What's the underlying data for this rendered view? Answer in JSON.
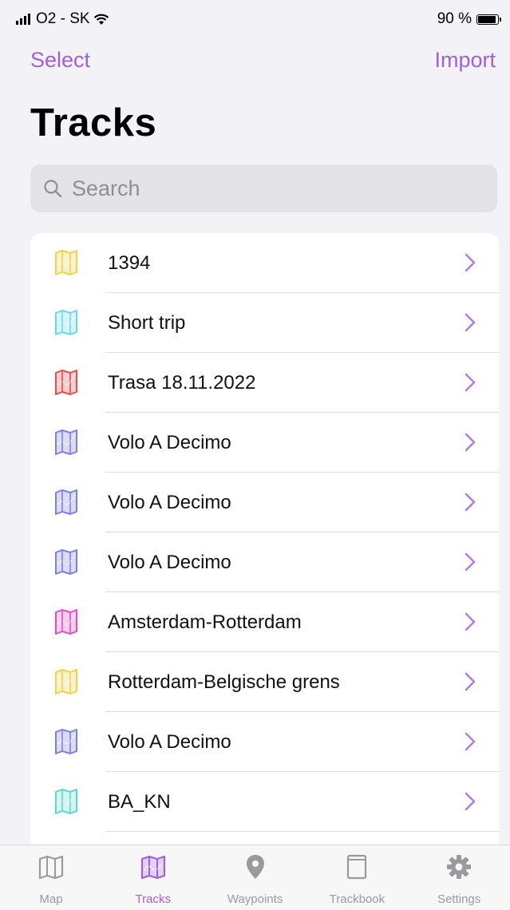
{
  "status_bar": {
    "carrier": "O2 - SK",
    "battery": "90 %",
    "battery_level": 0.9
  },
  "nav": {
    "select_label": "Select",
    "import_label": "Import"
  },
  "title": "Tracks",
  "search": {
    "placeholder": "Search",
    "value": ""
  },
  "tracks": [
    {
      "name": "1394",
      "color": "#f2d24a"
    },
    {
      "name": "Short trip",
      "color": "#6fd6e8"
    },
    {
      "name": "Trasa 18.11.2022",
      "color": "#e0504c"
    },
    {
      "name": "Volo A Decimo",
      "color": "#7e7fe0"
    },
    {
      "name": "Volo A Decimo",
      "color": "#7e7fe0"
    },
    {
      "name": "Volo A Decimo",
      "color": "#7e7fe0"
    },
    {
      "name": "Amsterdam-Rotterdam",
      "color": "#e04fc0"
    },
    {
      "name": "Rotterdam-Belgische grens",
      "color": "#f2d24a"
    },
    {
      "name": "Volo A Decimo",
      "color": "#7e7fe0"
    },
    {
      "name": "BA_KN",
      "color": "#5fd6d0"
    }
  ],
  "tabs": [
    {
      "label": "Map",
      "icon": "map-icon",
      "active": false
    },
    {
      "label": "Tracks",
      "icon": "tracks-icon",
      "active": true
    },
    {
      "label": "Waypoints",
      "icon": "pin-icon",
      "active": false
    },
    {
      "label": "Trackbook",
      "icon": "book-icon",
      "active": false
    },
    {
      "label": "Settings",
      "icon": "gear-icon",
      "active": false
    }
  ],
  "colors": {
    "accent": "#a35fd6",
    "chevron": "#b07fdc",
    "inactive": "#9a9a9e"
  }
}
